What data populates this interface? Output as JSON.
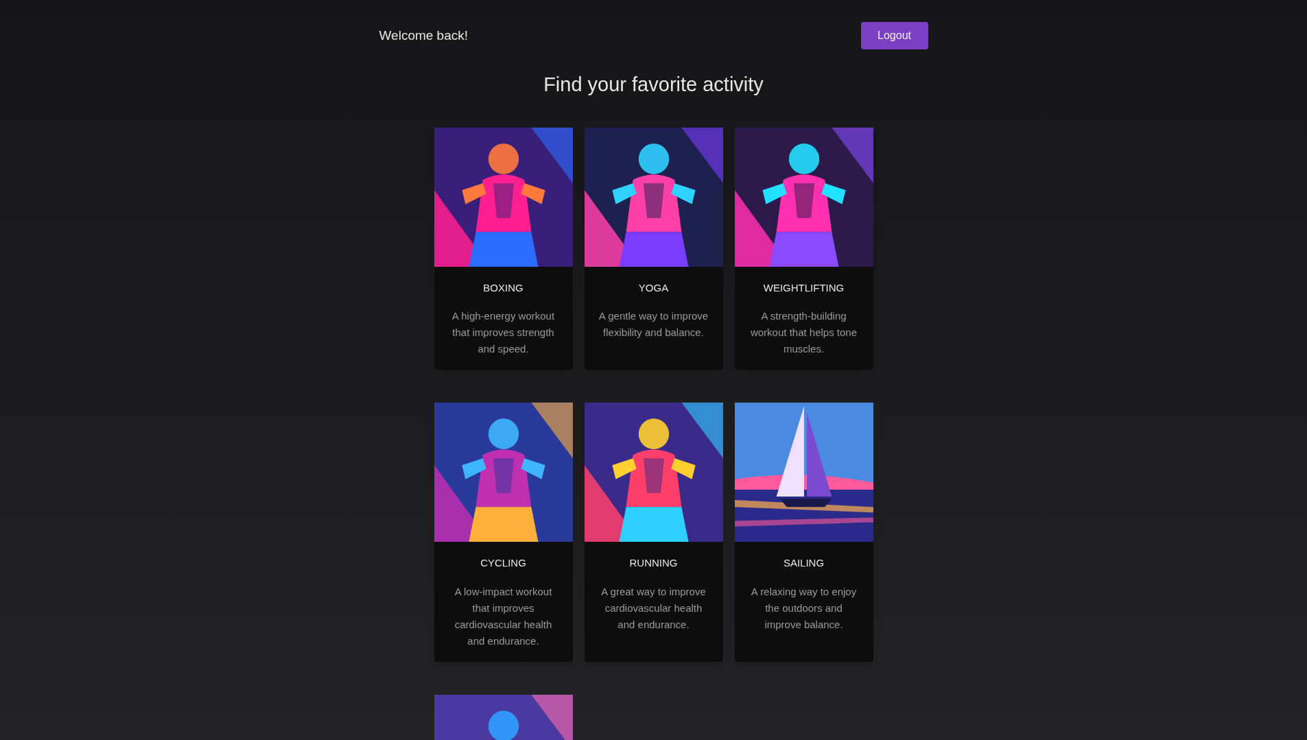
{
  "header": {
    "greeting": "Welcome back!",
    "logout_button": "Logout"
  },
  "title": "Find your favorite activity",
  "activities": [
    {
      "kind": "card",
      "name": "BOXING",
      "description": "A high-energy workout that improves strength and speed."
    },
    {
      "kind": "card",
      "name": "YOGA",
      "description": "A gentle way to improve flexibility and balance."
    },
    {
      "kind": "card",
      "name": "WEIGHTLIFTING",
      "description": "A strength-building workout that helps tone muscles."
    },
    {
      "kind": "card",
      "name": "CYCLING",
      "description": "A low-impact workout that improves cardiovascular health and endurance."
    },
    {
      "kind": "card",
      "name": "RUNNING",
      "description": "A great way to improve cardiovascular health and endurance."
    },
    {
      "kind": "card",
      "name": "SAILING",
      "description": "A relaxing way to enjoy the outdoors and improve balance."
    },
    {
      "kind": "picture"
    }
  ]
}
